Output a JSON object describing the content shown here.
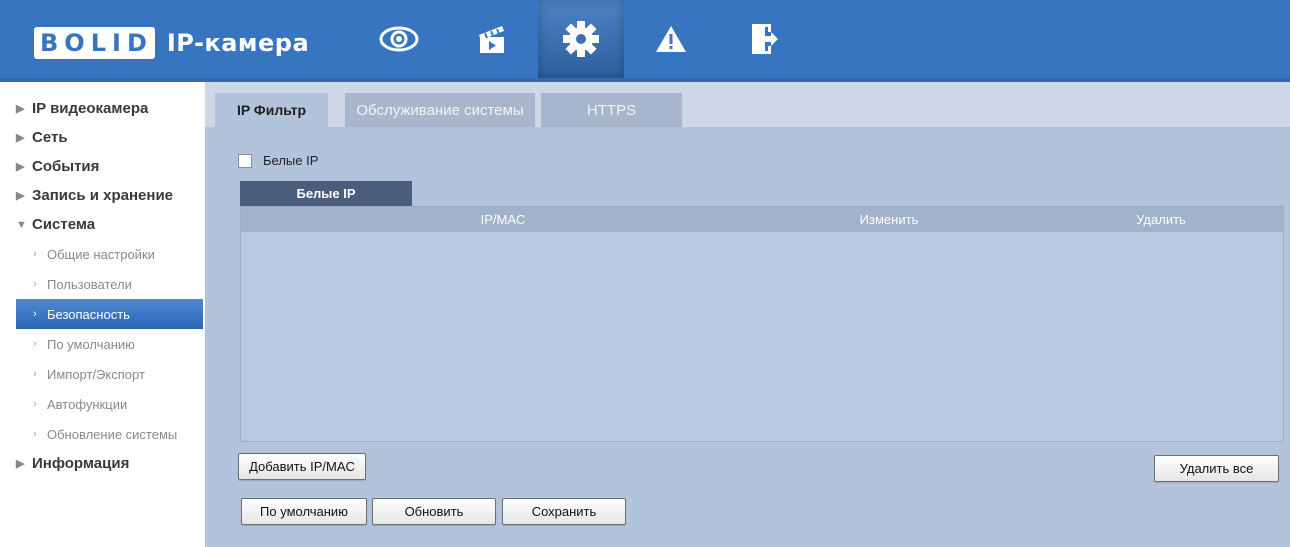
{
  "header": {
    "logo_letters": [
      "B",
      "O",
      "L",
      "I",
      "D"
    ],
    "logo_text": "BOLID",
    "product": "IP-камера",
    "nav": [
      {
        "icon": "eye-icon",
        "name": "live-view"
      },
      {
        "icon": "clapperboard-icon",
        "name": "playback"
      },
      {
        "icon": "gear-icon",
        "name": "settings",
        "active": true
      },
      {
        "icon": "warning-icon",
        "name": "alarm"
      },
      {
        "icon": "logout-icon",
        "name": "logout"
      }
    ]
  },
  "sidebar": {
    "groups": [
      {
        "label": "IP видеокамера"
      },
      {
        "label": "Сеть"
      },
      {
        "label": "События"
      },
      {
        "label": "Запись и хранение"
      },
      {
        "label": "Система",
        "expanded": true
      }
    ],
    "system_items": [
      {
        "label": "Общие настройки"
      },
      {
        "label": "Пользователи"
      },
      {
        "label": "Безопасность",
        "active": true
      },
      {
        "label": "По умолчанию"
      },
      {
        "label": "Импорт/Экспорт"
      },
      {
        "label": "Автофункции"
      },
      {
        "label": "Обновление системы"
      }
    ],
    "last_group": {
      "label": "Информация"
    }
  },
  "tabs": [
    "IP Фильтр",
    "Обслуживание системы",
    "HTTPS"
  ],
  "filter": {
    "checkbox_label": "Белые IP",
    "checked": false,
    "subtab_label": "Белые IP",
    "columns": {
      "ip_mac": "IP/MAC",
      "edit": "Изменить",
      "delete": "Удалить"
    },
    "rows": []
  },
  "buttons": {
    "add": "Добавить IP/MAC",
    "delete_all": "Удалить все",
    "default": "По умолчанию",
    "refresh": "Обновить",
    "save": "Сохранить"
  },
  "colors": {
    "header": "#3875c1",
    "panel": "#b3c3db",
    "active_item": "#2c66b4",
    "subtab": "#4a5d7a"
  }
}
